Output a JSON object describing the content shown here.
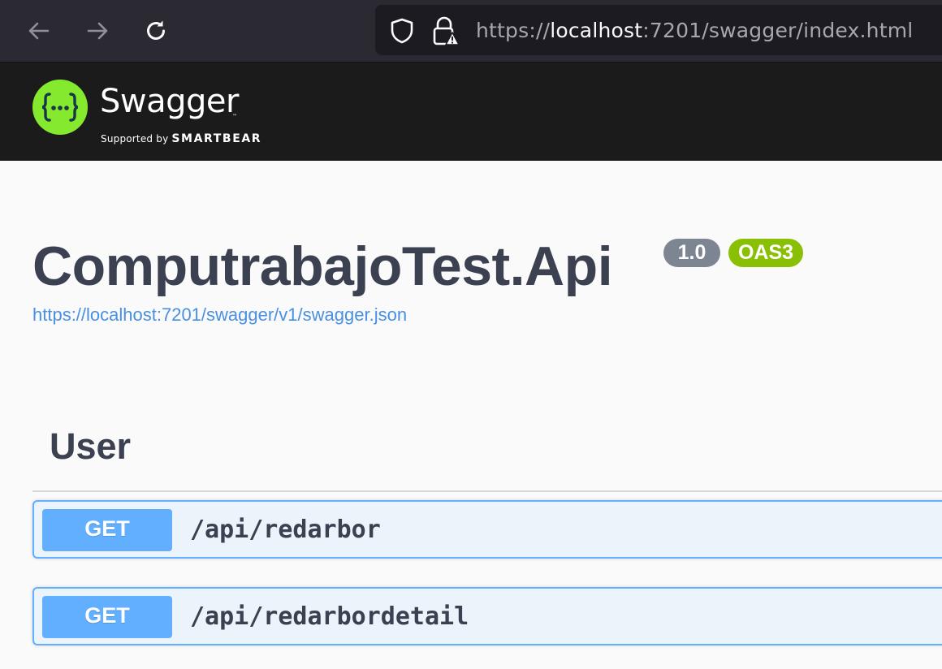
{
  "browser": {
    "url_scheme": "https://",
    "url_host": "localhost",
    "url_rest": ":7201/swagger/index.html"
  },
  "topbar": {
    "brand": "Swagger",
    "tm": "™",
    "supported_by": "Supported by",
    "company": "SMARTBEAR",
    "logo_glyph": "{…}",
    "colors": {
      "background": "#1b1b1b",
      "logo_green": "#85ea2d"
    }
  },
  "info": {
    "title": "ComputrabajoTest.Api",
    "version": "1.0",
    "oas": "OAS3",
    "spec_url": "https://localhost:7201/swagger/v1/swagger.json"
  },
  "tags": [
    {
      "name": "User",
      "operations": [
        {
          "method": "GET",
          "path": "/api/redarbor"
        },
        {
          "method": "GET",
          "path": "/api/redarbordetail"
        }
      ]
    }
  ],
  "colors": {
    "get": "#61affe",
    "get_bg": "#ebf3fb",
    "text": "#3b4151",
    "link": "#4990e2",
    "version_badge": "#7d8492",
    "oas_badge": "#89bf04"
  }
}
